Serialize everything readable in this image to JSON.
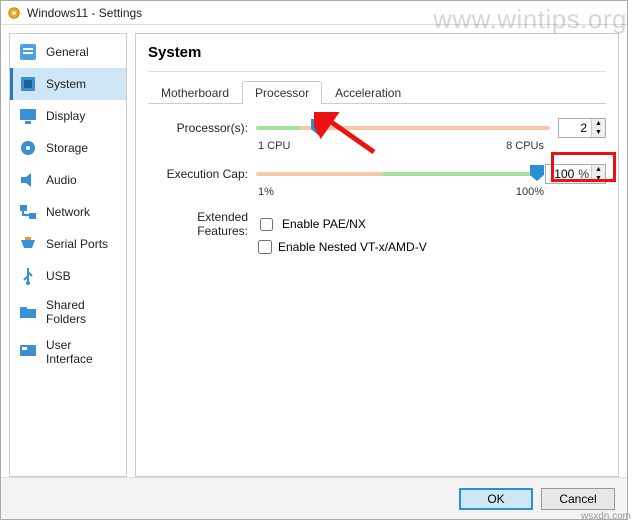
{
  "watermark": "www.wintips.org",
  "watermark_small": "wsxdn.com",
  "window": {
    "title": "Windows11 - Settings"
  },
  "sidebar": {
    "items": [
      {
        "label": "General",
        "icon": "general-icon",
        "selected": false
      },
      {
        "label": "System",
        "icon": "system-icon",
        "selected": true
      },
      {
        "label": "Display",
        "icon": "display-icon",
        "selected": false
      },
      {
        "label": "Storage",
        "icon": "storage-icon",
        "selected": false
      },
      {
        "label": "Audio",
        "icon": "audio-icon",
        "selected": false
      },
      {
        "label": "Network",
        "icon": "network-icon",
        "selected": false
      },
      {
        "label": "Serial Ports",
        "icon": "serial-icon",
        "selected": false
      },
      {
        "label": "USB",
        "icon": "usb-icon",
        "selected": false
      },
      {
        "label": "Shared Folders",
        "icon": "shared-icon",
        "selected": false
      },
      {
        "label": "User Interface",
        "icon": "ui-icon",
        "selected": false
      }
    ]
  },
  "content": {
    "title": "System",
    "tabs": [
      {
        "label": "Motherboard",
        "active": false
      },
      {
        "label": "Processor",
        "active": true
      },
      {
        "label": "Acceleration",
        "active": false
      }
    ],
    "processor": {
      "label": "Processor(s):",
      "value": "2",
      "min_label": "1 CPU",
      "max_label": "8 CPUs",
      "thumb_percent": 21
    },
    "execution_cap": {
      "label": "Execution Cap:",
      "value": "100",
      "unit": "%",
      "min_label": "1%",
      "max_label": "100%",
      "thumb_percent": 100
    },
    "extended_features_label": "Extended Features:",
    "features": [
      {
        "label": "Enable PAE/NX",
        "checked": false
      },
      {
        "label": "Enable Nested VT-x/AMD-V",
        "checked": false
      }
    ]
  },
  "footer": {
    "ok": "OK",
    "cancel": "Cancel"
  }
}
